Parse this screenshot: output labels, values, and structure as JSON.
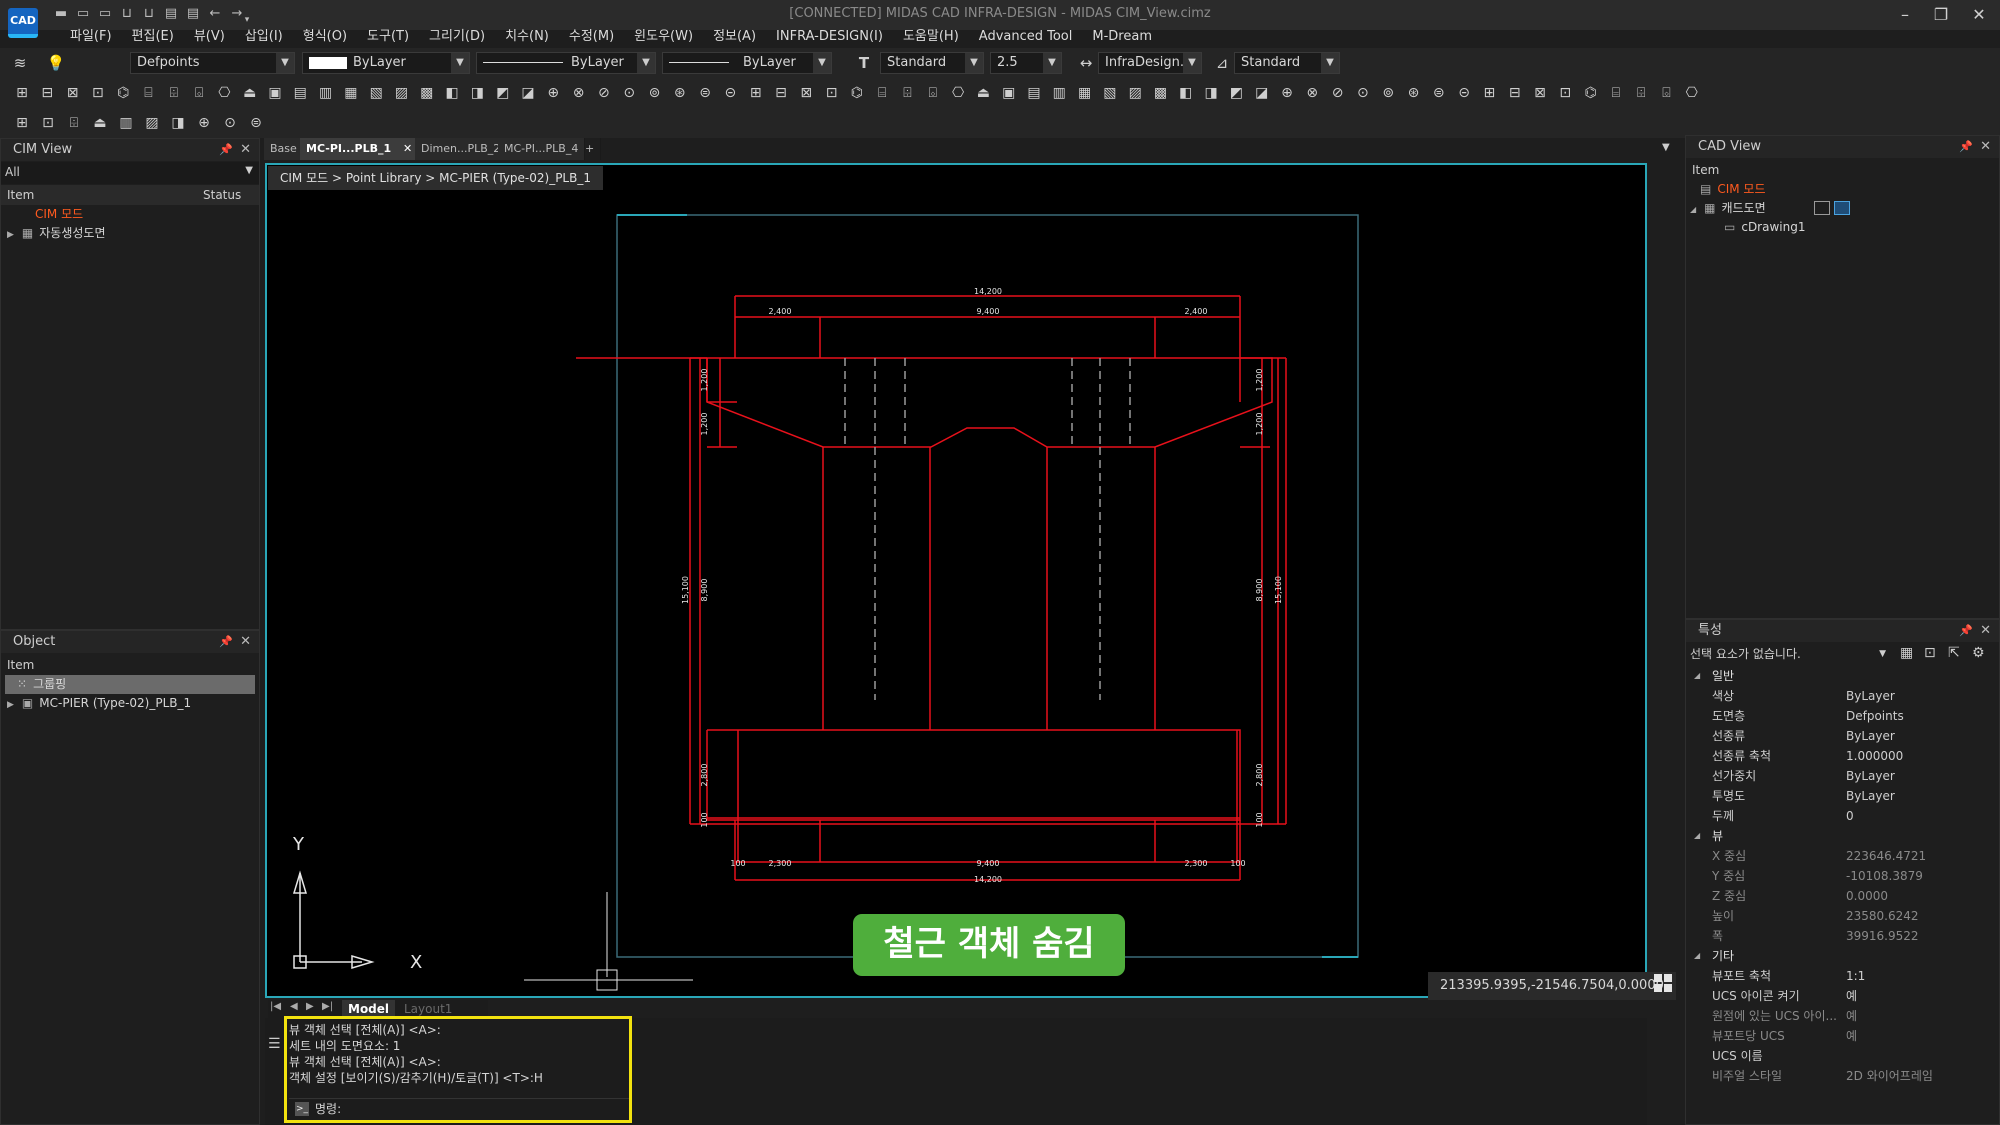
{
  "app": {
    "logo": "CAD",
    "window_title": "[CONNECTED] MIDAS CAD INFRA-DESIGN - MIDAS CIM_View.cimz",
    "quick_icons": [
      "new-file-icon",
      "open-folder-icon",
      "open-icon",
      "save-icon",
      "save-as-icon",
      "print-icon",
      "print-preview-icon",
      "undo-icon",
      "redo-icon",
      "dropdown-icon"
    ]
  },
  "menu": [
    "파일(F)",
    "편집(E)",
    "뷰(V)",
    "삽입(I)",
    "형식(O)",
    "도구(T)",
    "그리기(D)",
    "치수(N)",
    "수정(M)",
    "윈도우(W)",
    "정보(A)",
    "INFRA-DESIGN(I)",
    "도움말(H)",
    "Advanced Tool",
    "M-Dream"
  ],
  "toolbar": {
    "layer": "Defpoints",
    "color": "ByLayer",
    "linetype": "ByLayer",
    "lineweight": "ByLayer",
    "text_style": "Standard",
    "text_height": "2.5",
    "dim_style": "InfraDesign...",
    "table_style": "Standard"
  },
  "cim_view": {
    "title": "CIM View",
    "filter": "All",
    "col_item": "Item",
    "col_status": "Status",
    "root": "CIM 모드",
    "child": "자동생성도면"
  },
  "object_panel": {
    "title": "Object",
    "col_item": "Item",
    "group": "그룹핑",
    "child": "MC-PIER (Type-02)_PLB_1"
  },
  "tabs": [
    {
      "label": "Base",
      "active": false
    },
    {
      "label": "MC-PI...PLB_1",
      "active": true
    },
    {
      "label": "Dimen...PLB_2",
      "active": false
    },
    {
      "label": "MC-PI...PLB_4",
      "active": false
    }
  ],
  "breadcrumb": "CIM 모드 > Point Library > MC-PIER (Type-02)_PLB_1",
  "drawing": {
    "top_total": "14,200",
    "top_left": "2,400",
    "top_mid": "9,400",
    "top_right": "2,400",
    "left_h1": "1,200",
    "left_h2": "1,200",
    "left_mid": "8,900",
    "left_total": "15,100",
    "left_bot": "2,800",
    "left_bot2": "100",
    "right_h1": "1,200",
    "right_h2": "1,200",
    "right_mid": "8,900",
    "right_total": "15,100",
    "right_bot": "2,800",
    "right_bot2": "100",
    "bot_left_small": "100",
    "bot_left": "2,300",
    "bot_mid": "9,400",
    "bot_right": "2,300",
    "bot_right_small": "100",
    "bot_total": "14,200"
  },
  "ucs": {
    "x": "X",
    "y": "Y"
  },
  "badge": "철근 객체 숨김",
  "coords": "213395.9395,-21546.7504,0.0000",
  "layout_tabs": [
    "Model",
    "Layout1"
  ],
  "command": {
    "lines": [
      "뷰 객체 선택 [전체(A)] <A>:",
      "세트 내의 도면요소: 1",
      "뷰 객체 선택 [전체(A)] <A>:",
      "객체 설정 [보이기(S)/감추기(H)/토글(T)] <T>:H"
    ],
    "prompt": "명령:"
  },
  "cad_view": {
    "title": "CAD View",
    "col_item": "Item",
    "root": "CIM 모드",
    "child": "캐드도면",
    "leaf": "cDrawing1"
  },
  "properties": {
    "title": "특성",
    "selection": "선택 요소가 없습니다.",
    "cat_general": "일반",
    "cat_view": "뷰",
    "cat_misc": "기타",
    "general": [
      {
        "k": "색상",
        "v": "ByLayer"
      },
      {
        "k": "도면층",
        "v": "Defpoints"
      },
      {
        "k": "선종류",
        "v": "ByLayer"
      },
      {
        "k": "선종류 축척",
        "v": "1.000000"
      },
      {
        "k": "선가중치",
        "v": "ByLayer"
      },
      {
        "k": "투명도",
        "v": "ByLayer"
      },
      {
        "k": "두께",
        "v": "0"
      }
    ],
    "view": [
      {
        "k": "X 중심",
        "v": "223646.4721"
      },
      {
        "k": "Y 중심",
        "v": "-10108.3879"
      },
      {
        "k": "Z 중심",
        "v": "0.0000"
      },
      {
        "k": "높이",
        "v": "23580.6242"
      },
      {
        "k": "폭",
        "v": "39916.9522"
      }
    ],
    "misc": [
      {
        "k": "뷰포트 축척",
        "v": "1:1"
      },
      {
        "k": "UCS 아이콘 켜기",
        "v": "예"
      },
      {
        "k": "원점에 있는 UCS 아이...",
        "v": "예"
      },
      {
        "k": "뷰포트당 UCS",
        "v": "예"
      },
      {
        "k": "UCS 이름",
        "v": ""
      },
      {
        "k": "비주얼 스타일",
        "v": "2D 와이어프레임"
      }
    ]
  },
  "colors": {
    "accent": "#2aa7b8",
    "drawing": "#e8111b",
    "badge": "#4fae3c",
    "highlight": "#f2e20f",
    "tree_root": "#ff5a1f"
  }
}
